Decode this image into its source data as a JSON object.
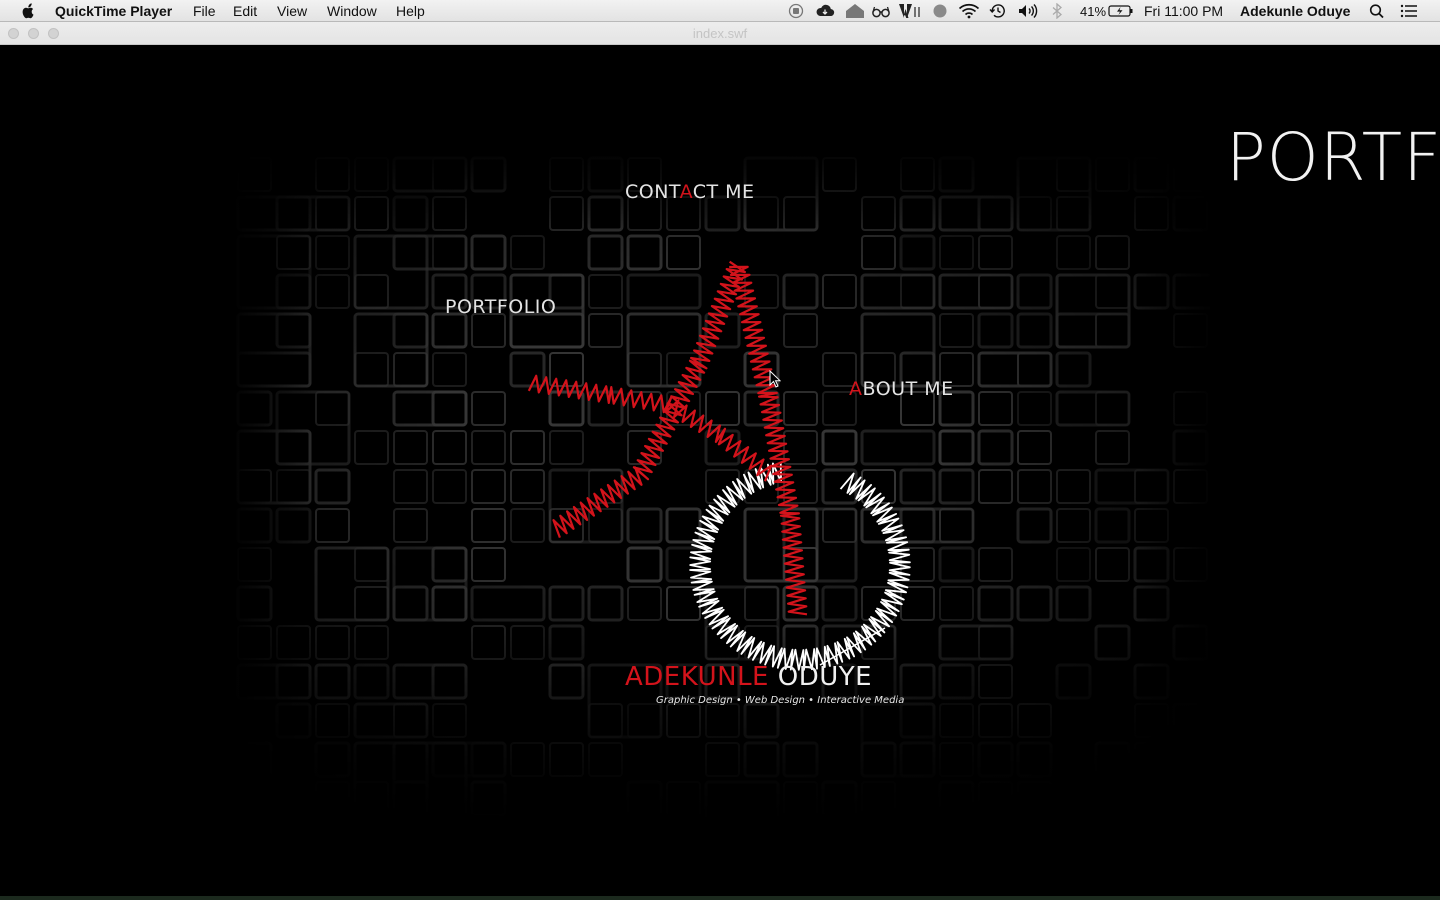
{
  "menubar": {
    "app_name": "QuickTime Player",
    "menus": [
      "File",
      "Edit",
      "View",
      "Window",
      "Help"
    ],
    "status": {
      "battery_percent": "41%",
      "clock": "Fri 11:00 PM",
      "user": "Adekunle Oduye"
    },
    "icons": [
      "apple-icon",
      "record-icon",
      "cloud-icon",
      "home-icon",
      "glasses-icon",
      "adobe-icon",
      "circle-icon",
      "wifi-icon",
      "time-machine-icon",
      "volume-icon",
      "bluetooth-icon",
      "battery-icon",
      "spotlight-icon",
      "notification-center-icon"
    ]
  },
  "window": {
    "title": "index.swf"
  },
  "site": {
    "nav": {
      "contact": {
        "pre": "CONT",
        "accent": "A",
        "post": "CT ME"
      },
      "portfolio": {
        "pre": "PORTFOLIO",
        "accent": "",
        "post": ""
      },
      "about": {
        "pre": "",
        "accent": "A",
        "post": "BOUT ME"
      }
    },
    "brand": {
      "first": "ADEKUNLE",
      "last": "ODUYE",
      "tagline": "Graphic Design • Web Design • Interactive Media"
    },
    "heading": "PORTFO",
    "colors": {
      "accent": "#d3131b",
      "text": "#e4e4e4",
      "background": "#000000"
    }
  }
}
